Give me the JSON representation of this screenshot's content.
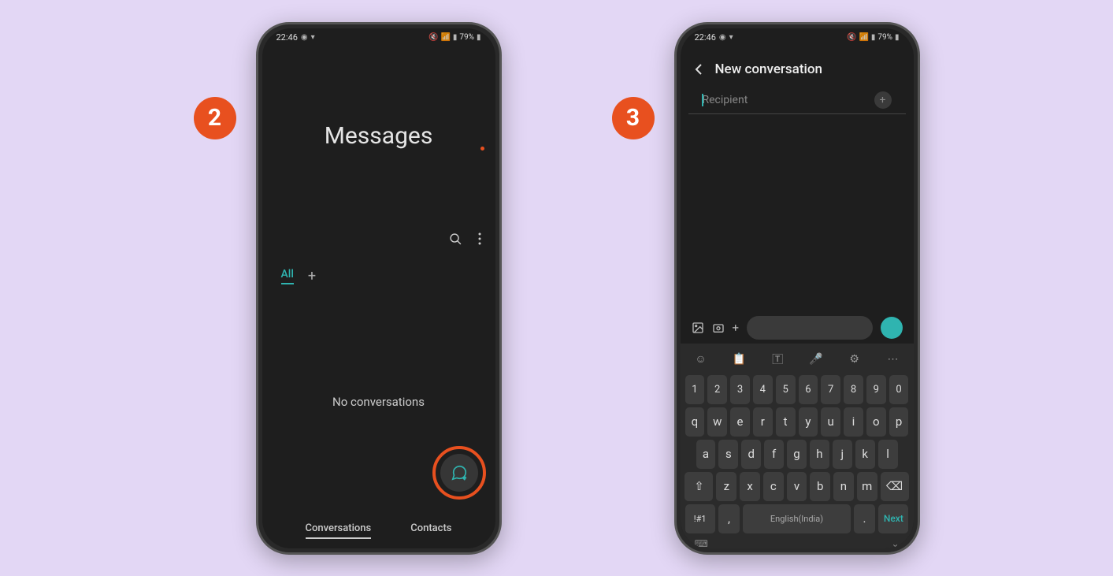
{
  "steps": {
    "step2": "2",
    "step3": "3"
  },
  "status": {
    "time": "22:46",
    "battery": "79%"
  },
  "phone1": {
    "title": "Messages",
    "tab_all": "All",
    "empty": "No conversations",
    "bottom_tabs": {
      "conversations": "Conversations",
      "contacts": "Contacts"
    }
  },
  "phone2": {
    "title": "New conversation",
    "recipient_placeholder": "Recipient",
    "keyboard": {
      "row_num": [
        "1",
        "2",
        "3",
        "4",
        "5",
        "6",
        "7",
        "8",
        "9",
        "0"
      ],
      "row1": [
        "q",
        "w",
        "e",
        "r",
        "t",
        "y",
        "u",
        "i",
        "o",
        "p"
      ],
      "row2": [
        "a",
        "s",
        "d",
        "f",
        "g",
        "h",
        "j",
        "k",
        "l"
      ],
      "row3": [
        "z",
        "x",
        "c",
        "v",
        "b",
        "n",
        "m"
      ],
      "shift": "⇧",
      "backspace": "⌫",
      "symbols": "!#1",
      "comma": ",",
      "space": "English(India)",
      "period": ".",
      "next": "Next"
    }
  }
}
